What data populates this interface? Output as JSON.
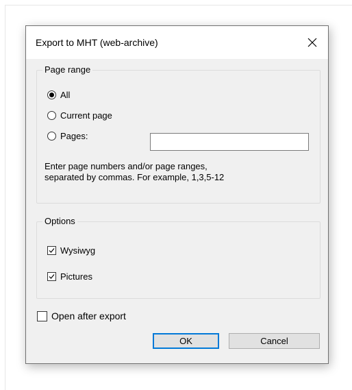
{
  "dialog": {
    "title": "Export to MHT (web-archive)",
    "close_icon": "close-icon"
  },
  "page_range": {
    "title": "Page range",
    "options": [
      {
        "label": "All",
        "selected": true
      },
      {
        "label": "Current page",
        "selected": false
      },
      {
        "label": "Pages:",
        "selected": false
      }
    ],
    "pages_value": "",
    "hint_line1": "Enter page numbers and/or page ranges,",
    "hint_line2": "separated by commas. For example, 1,3,5-12"
  },
  "options": {
    "title": "Options",
    "wysiwyg": {
      "label": "Wysiwyg",
      "checked": true
    },
    "pictures": {
      "label": "Pictures",
      "checked": true
    }
  },
  "open_after_export": {
    "label": "Open after export",
    "checked": false
  },
  "buttons": {
    "ok": "OK",
    "cancel": "Cancel"
  },
  "colors": {
    "accent": "#0078d7",
    "dialog_bg": "#f0f0f0",
    "titlebar_bg": "#ffffff"
  }
}
